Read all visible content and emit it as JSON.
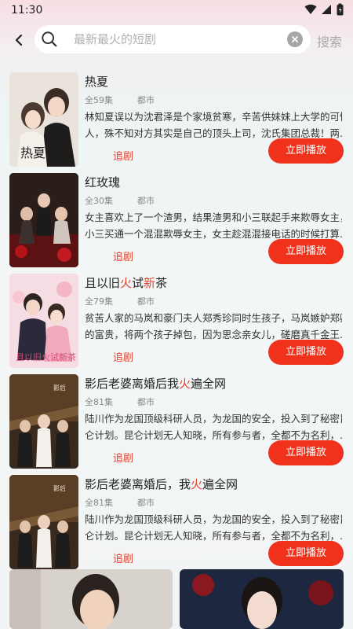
{
  "status": {
    "time": "11:30"
  },
  "search": {
    "placeholder": "最新最火的短剧",
    "submit_label": "搜索"
  },
  "items": [
    {
      "title_parts": [
        "热夏"
      ],
      "episodes": "全59集",
      "genre": "都市",
      "desc_lines": [
        "林知夏误以为沈君泽是个家境贫寒，辛苦供妹妹上大学的可怜",
        "人，殊不知对方其实是自己的顶头上司，沈氏集团总裁！两..."
      ],
      "follow_label": "追剧",
      "play_label": "立即播放"
    },
    {
      "title_parts": [
        "红玫瑰"
      ],
      "episodes": "全30集",
      "genre": "都市",
      "desc_lines": [
        "女主喜欢上了一个渣男，结果渣男和小三联起手来欺辱女主，",
        "小三买通一个混混欺辱女主，女主趁混混接电话的时候打算..."
      ],
      "follow_label": "追剧",
      "play_label": "立即播放"
    },
    {
      "title_parts": [
        "且以旧",
        "火",
        "试",
        "新",
        "茶"
      ],
      "episodes": "全79集",
      "genre": "都市",
      "desc_lines": [
        "贫苦人家的马岚和豪门夫人郑秀珍同时生孩子，马岚嫉妒郑卿",
        "的富贵，将两个孩子掉包，因为思念亲女儿，磋磨真千金王..."
      ],
      "follow_label": "追剧",
      "play_label": "立即播放"
    },
    {
      "title_parts": [
        "影后老婆离婚后我",
        "火",
        "遍全网"
      ],
      "episodes": "全81集",
      "genre": "都市",
      "desc_lines": [
        "陆川作为龙国顶级科研人员，为龙国的安全，投入到了秘密昆",
        "仑计划。昆仑计划无人知晓，所有参与者，全都不为名利，..."
      ],
      "follow_label": "追剧",
      "play_label": "立即播放"
    },
    {
      "title_parts": [
        "影后老婆离婚后，我",
        "火",
        "遍全网"
      ],
      "episodes": "全81集",
      "genre": "都市",
      "desc_lines": [
        "陆川作为龙国顶级科研人员，为龙国的安全，投入到了秘密昆",
        "仑计划。昆仑计划无人知晓，所有参与者，全都不为名利，..."
      ],
      "follow_label": "追剧",
      "play_label": "立即播放"
    }
  ],
  "colors": {
    "accent": "#f0321c",
    "highlight": "#e8412c"
  }
}
